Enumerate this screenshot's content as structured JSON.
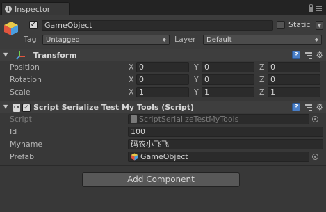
{
  "tab": {
    "label": "Inspector"
  },
  "header": {
    "object_name": "GameObject",
    "active": true,
    "static_label": "Static",
    "static_checked": false,
    "tag_label": "Tag",
    "tag_value": "Untagged",
    "layer_label": "Layer",
    "layer_value": "Default"
  },
  "transform": {
    "title": "Transform",
    "rows": [
      {
        "label": "Position",
        "x": "0",
        "y": "0",
        "z": "0"
      },
      {
        "label": "Rotation",
        "x": "0",
        "y": "0",
        "z": "0"
      },
      {
        "label": "Scale",
        "x": "1",
        "y": "1",
        "z": "1"
      }
    ],
    "axis_labels": [
      "X",
      "Y",
      "Z"
    ]
  },
  "script_component": {
    "icon_text": "C#",
    "title": "Script Serialize Test My Tools (Script)",
    "script_label": "Script",
    "script_value": "ScriptSerializeTestMyTools",
    "fields": [
      {
        "label": "Id",
        "value": "100"
      },
      {
        "label": "Myname",
        "value": "码农小飞飞"
      }
    ],
    "prefab_label": "Prefab",
    "prefab_value": "GameObject"
  },
  "add_component": {
    "label": "Add Component"
  },
  "icons": {
    "tab": "info-icon",
    "lock": "lock-icon",
    "menu": "menu-icon",
    "help": "help-icon",
    "preset": "preset-icon",
    "gear": "gear-icon"
  },
  "colors": {
    "panel": "#383838",
    "field": "#2b2b2b",
    "help_blue": "#4a7fc7"
  }
}
